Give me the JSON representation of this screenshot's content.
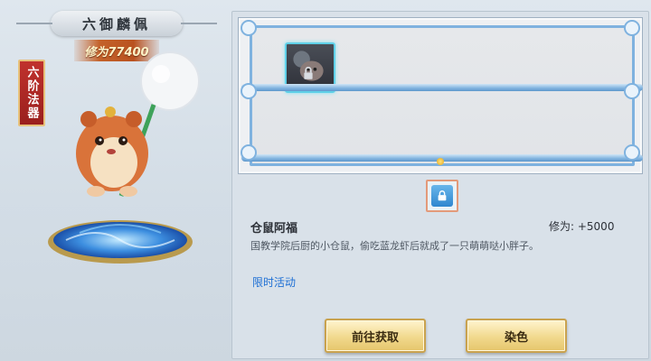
{
  "showcase": {
    "series_title": "六御麟佩",
    "power_label": "修为77400",
    "grade_label": "六阶法器"
  },
  "shelf": {
    "slots": [
      {
        "icon": "hamster-ghost-item-icon",
        "selected": true,
        "locked": true
      }
    ],
    "page_indicator_count": 1
  },
  "detail": {
    "name": "仓鼠阿福",
    "bonus": "修为: +5000",
    "description": "国教学院后厨的小仓鼠，偷吃蓝龙虾后就成了一只萌萌哒小胖子。",
    "source_link": "限时活动"
  },
  "buttons": {
    "obtain": "前往获取",
    "dye": "染色"
  },
  "colors": {
    "accent_blue": "#7fb2df",
    "link_blue": "#1e6fd4",
    "gold_button": "#f1d98d",
    "grade_red": "#9a1f1d"
  }
}
